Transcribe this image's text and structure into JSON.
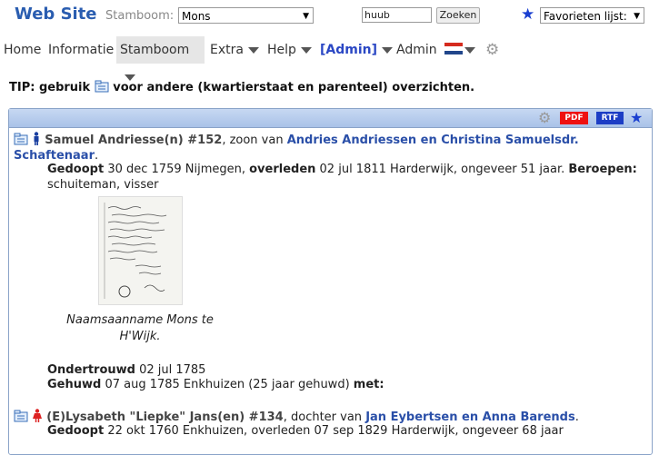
{
  "header": {
    "site_title": "Web Site",
    "stamboom_label": "Stamboom:",
    "stamboom_value": "Mons",
    "search_value": "huub",
    "search_button": "Zoeken",
    "favorites_value": "Favorieten lijst:"
  },
  "menu": {
    "home": "Home",
    "informatie": "Informatie",
    "stamboom": "Stamboom",
    "extra": "Extra",
    "help": "Help",
    "admin_bracket": "[Admin]",
    "admin": "Admin"
  },
  "tip": {
    "prefix": "TIP: gebruik",
    "suffix": "voor andere (kwartierstaat en parenteel) overzichten."
  },
  "panel": {
    "pdf": "PDF",
    "rtf": "RTF"
  },
  "person1": {
    "name": "Samuel Andriesse(n) #152",
    "relation": ", zoon van ",
    "parents": "Andries Andriessen en Christina Samuelsdr. Schaftenaar",
    "period": ".",
    "label_baptized": "Gedoopt",
    "baptized": " 30 dec 1759 Nijmegen, ",
    "label_died": "overleden",
    "died": " 02 jul 1811 Harderwijk, ongeveer 51 jaar. ",
    "label_occupation": "Beroepen:",
    "occupation": "schuiteman, visser"
  },
  "photo": {
    "caption": "Naamsaanname Mons te H'Wijk."
  },
  "marriage": {
    "label_ondertrouwd": "Ondertrouwd",
    "ondertrouwd": " 02 jul 1785",
    "label_gehuwd": "Gehuwd",
    "gehuwd": " 07 aug 1785 Enkhuizen (25 jaar gehuwd) ",
    "label_met": "met:"
  },
  "person2": {
    "name": "(E)Lysabeth \"Liepke\" Jans(en) #134",
    "relation": ", dochter van ",
    "parents": "Jan Eybertsen en Anna Barends",
    "period": ".",
    "label_baptized": "Gedoopt",
    "baptized": " 22 okt 1760 Enkhuizen, overleden 07 sep 1829 Harderwijk, ongeveer 68 jaar"
  },
  "colors": {
    "accent": "#2a5db0",
    "link": "#2a4fa8",
    "pdf": "#e11111",
    "rtf": "#1c3dc5"
  }
}
